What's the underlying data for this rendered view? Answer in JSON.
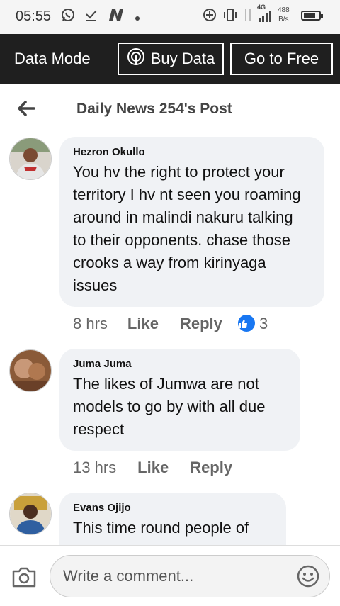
{
  "status": {
    "time": "05:55",
    "network": "4G",
    "speed_value": "488",
    "speed_unit": "B/s",
    "battery_level": 0.8
  },
  "databar": {
    "mode_label": "Data Mode",
    "buy_label": "Buy Data",
    "free_label": "Go to Free"
  },
  "header": {
    "title": "Daily News 254's Post"
  },
  "comments": [
    {
      "name": "Hezron Okullo",
      "text": "You hv the right to protect your territory I hv nt seen you roaming around in malindi nakuru talking to their opponents. chase those crooks a way from kirinyaga issues",
      "time": "8 hrs",
      "like": "Like",
      "reply": "Reply",
      "reactions": "3"
    },
    {
      "name": "Juma Juma",
      "text": "The likes of Jumwa are not models to go by with all due respect",
      "time": "13 hrs",
      "like": "Like",
      "reply": "Reply"
    },
    {
      "name": "Evans Ojijo",
      "text": "This time round people of"
    }
  ],
  "composer": {
    "placeholder": "Write a comment..."
  },
  "colors": {
    "accent": "#1877f2",
    "databar_bg": "#1f1f1f",
    "bubble_bg": "#f0f2f5"
  }
}
